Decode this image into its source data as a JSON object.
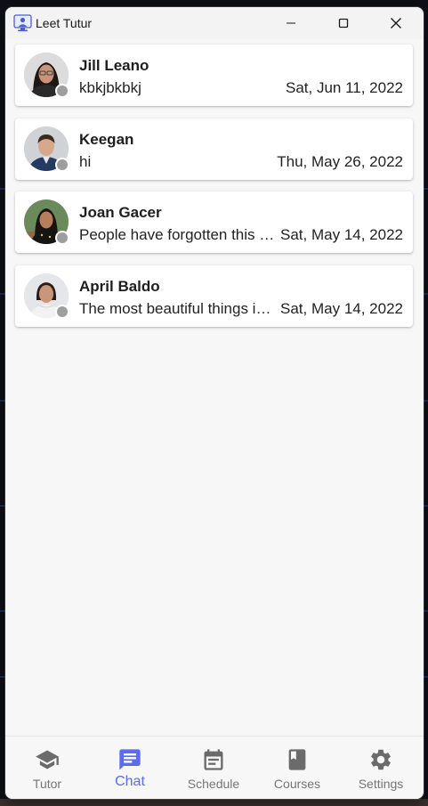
{
  "window": {
    "title": "Leet Tutur"
  },
  "chats": [
    {
      "name": "Jill Leano",
      "preview": "kbkjbkbkj",
      "date": "Sat, Jun 11, 2022",
      "status": "offline"
    },
    {
      "name": "Keegan",
      "preview": "hi",
      "date": "Thu, May 26, 2022",
      "status": "offline"
    },
    {
      "name": "Joan Gacer",
      "preview": "People have forgotten this …",
      "date": "Sat, May 14, 2022",
      "status": "offline"
    },
    {
      "name": "April Baldo",
      "preview": "The most beautiful things i…",
      "date": "Sat, May 14, 2022",
      "status": "offline"
    }
  ],
  "nav": {
    "items": [
      {
        "label": "Tutor",
        "icon": "graduation-cap-icon"
      },
      {
        "label": "Chat",
        "icon": "chat-bubble-icon"
      },
      {
        "label": "Schedule",
        "icon": "calendar-icon"
      },
      {
        "label": "Courses",
        "icon": "book-icon"
      },
      {
        "label": "Settings",
        "icon": "gear-icon"
      }
    ],
    "active": "Chat"
  },
  "colors": {
    "accent": "#5b6cf0",
    "inactive": "#757575",
    "status_offline": "#9e9e9e",
    "background": "#f7f7f7"
  }
}
